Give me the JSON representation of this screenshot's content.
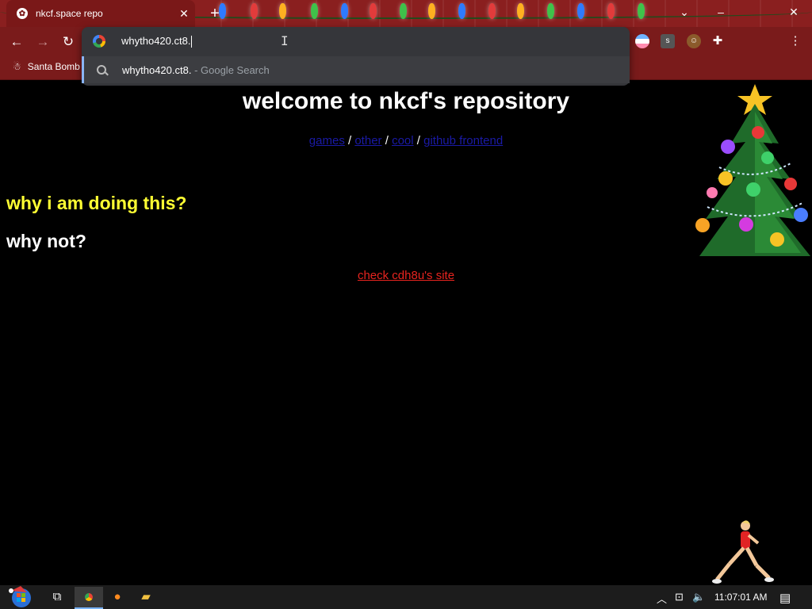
{
  "browser": {
    "tab": {
      "title": "nkcf.space repo"
    },
    "bookmarks": [
      {
        "label": "Santa Bomb"
      }
    ],
    "omnibox": {
      "value": "whytho420.ct8.",
      "suggestion": {
        "text": "whytho420.ct8.",
        "hint": " - Google Search"
      }
    }
  },
  "page": {
    "title": "welcome to nkcf's repository",
    "nav_links": [
      {
        "label": "games"
      },
      {
        "label": "other"
      },
      {
        "label": "cool"
      },
      {
        "label": "github frontend"
      }
    ],
    "separator": " / ",
    "heading_question": "why i am doing this?",
    "heading_answer": "why not?",
    "site_link": "check cdh8u's site"
  },
  "taskbar": {
    "clock": "11:07:01 AM"
  },
  "colors": {
    "titlebar": "#8a1f1f",
    "omnibox": "#35363a",
    "heading_yellow": "#ffff33",
    "site_link": "#e8241f",
    "nav_link": "#1a1aa6"
  }
}
